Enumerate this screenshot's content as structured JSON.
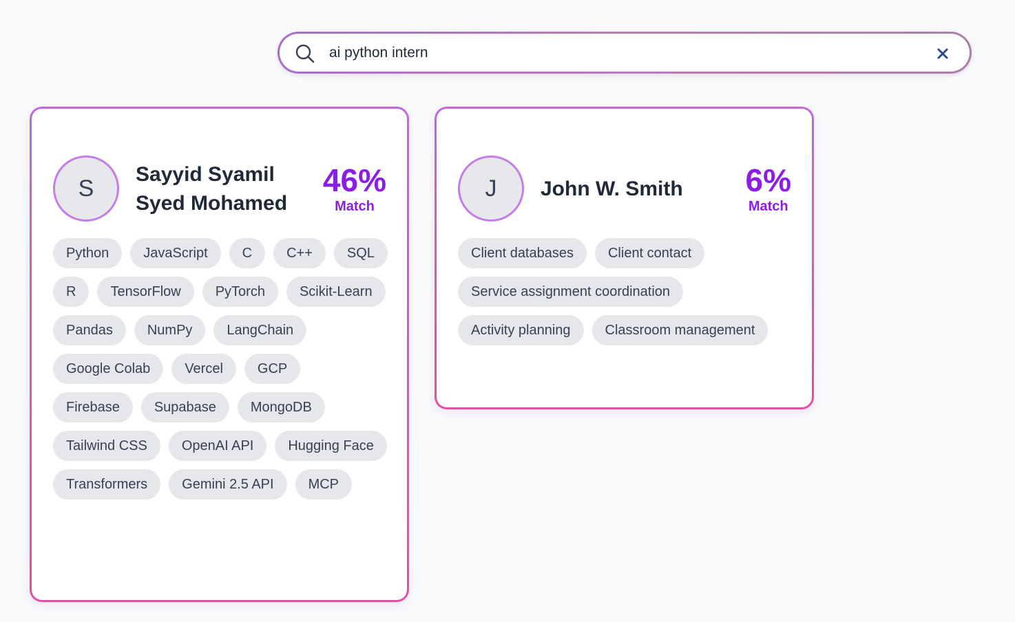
{
  "search": {
    "value": "ai python intern",
    "placeholder": ""
  },
  "icons": {
    "search": "search-icon",
    "clear": "close-icon"
  },
  "colors": {
    "accent_purple": "#8b1ee6",
    "card_border_top": "#c266e0",
    "card_border_bottom": "#e14fa2",
    "chip_bg": "#e5e7eb",
    "avatar_ring": "#c37ce8"
  },
  "candidates": [
    {
      "initial": "S",
      "name": "Sayyid Syamil Syed Mohamed",
      "match_percent": "46%",
      "match_label": "Match",
      "skills": [
        "Python",
        "JavaScript",
        "C",
        "C++",
        "SQL",
        "R",
        "TensorFlow",
        "PyTorch",
        "Scikit-Learn",
        "Pandas",
        "NumPy",
        "LangChain",
        "Google Colab",
        "Vercel",
        "GCP",
        "Firebase",
        "Supabase",
        "MongoDB",
        "Tailwind CSS",
        "OpenAI API",
        "Hugging Face",
        "Transformers",
        "Gemini 2.5 API",
        "MCP"
      ]
    },
    {
      "initial": "J",
      "name": "John W. Smith",
      "match_percent": "6%",
      "match_label": "Match",
      "skills": [
        "Client databases",
        "Client contact",
        "Service assignment coordination",
        "Activity planning",
        "Classroom management"
      ]
    }
  ]
}
